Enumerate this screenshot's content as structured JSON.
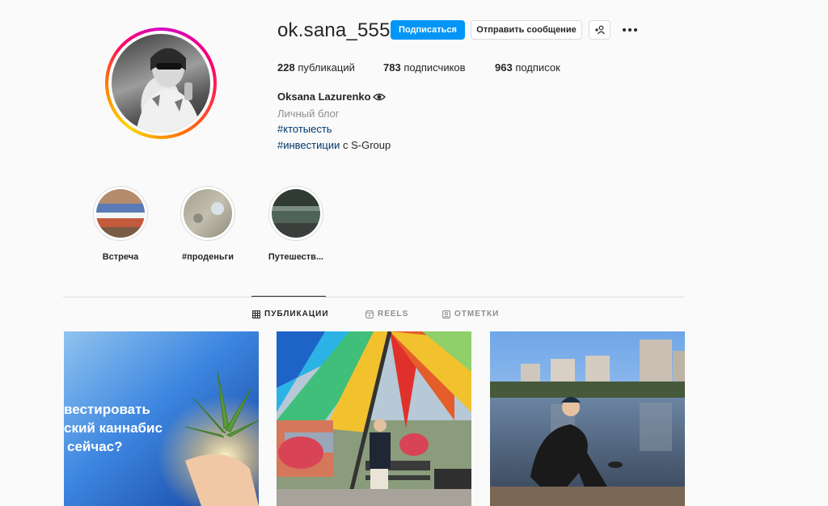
{
  "profile": {
    "username": "ok.sana_555",
    "follow_label": "Подписаться",
    "message_label": "Отправить сообщение",
    "add_user_icon": "add-user-icon",
    "more_icon": "more-options-icon",
    "stats": {
      "posts_count": "228",
      "posts_label": "публикаций",
      "followers_count": "783",
      "followers_label": "подписчиков",
      "following_count": "963",
      "following_label": "подписок"
    },
    "full_name": "Oksana Lazurenko",
    "category": "Личный блог",
    "bio_line1": "#ктотыесть",
    "bio_line2_tag": "#инвестиции",
    "bio_line2_rest": " с S-Group"
  },
  "highlights": [
    {
      "label": "Встреча"
    },
    {
      "label": "#проденьги"
    },
    {
      "label": "Путешеств..."
    }
  ],
  "tabs": [
    {
      "label": "ПУБЛИКАЦИИ",
      "icon": "grid-icon",
      "active": true
    },
    {
      "label": "REELS",
      "icon": "reels-icon",
      "active": false
    },
    {
      "label": "ОТМЕТКИ",
      "icon": "tagged-icon",
      "active": false
    }
  ],
  "posts": [
    {
      "overlay_line1": "вестировать",
      "overlay_line2": "ский каннабис",
      "overlay_line3": "сейчас?"
    },
    {
      "description_hidden": ""
    },
    {
      "description_hidden": ""
    }
  ],
  "colors": {
    "primary": "#0095f6",
    "link": "#00376b",
    "text": "#262626",
    "muted": "#8e8e8e",
    "border": "#dbdbdb"
  }
}
